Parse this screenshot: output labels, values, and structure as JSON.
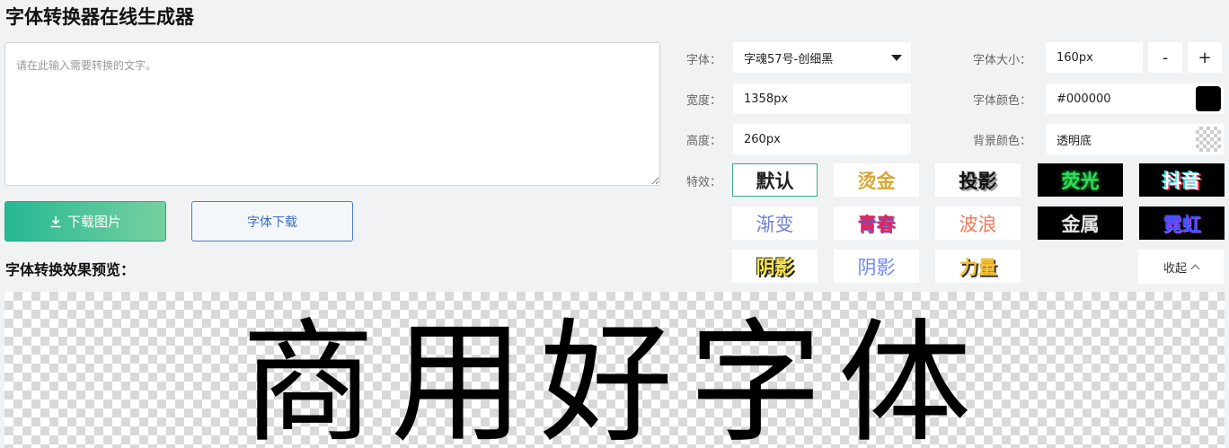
{
  "page": {
    "title": "字体转换器在线生成器"
  },
  "input": {
    "placeholder": "请在此输入需要转换的文字。"
  },
  "buttons": {
    "download_image": "下载图片",
    "font_download": "字体下载",
    "collapse": "收起"
  },
  "preview": {
    "label": "字体转换效果预览：",
    "text": "商用好字体"
  },
  "settings": {
    "font_label": "字体：",
    "font_value": "字魂57号-创细黑",
    "width_label": "宽度：",
    "width_value": "1358px",
    "height_label": "高度：",
    "height_value": "260px",
    "size_label": "字体大小：",
    "size_value": "160px",
    "minus": "-",
    "plus": "+",
    "color_label": "字体颜色：",
    "color_value": "#000000",
    "color_swatch": "#000000",
    "bg_label": "背景颜色：",
    "bg_value": "透明底"
  },
  "effects": {
    "label": "特效：",
    "items": [
      {
        "label": "默认",
        "selected": true
      },
      {
        "label": "烫金"
      },
      {
        "label": "投影"
      },
      {
        "label": "荧光"
      },
      {
        "label": "抖音"
      },
      {
        "label": "渐变"
      },
      {
        "label": "青春"
      },
      {
        "label": "波浪"
      },
      {
        "label": "金属"
      },
      {
        "label": "霓虹"
      },
      {
        "label": "阴影"
      },
      {
        "label": "阴影"
      },
      {
        "label": "力量"
      }
    ]
  },
  "colors": {
    "accent": "#26b894",
    "link_blue": "#3b6dc4",
    "page_bg": "#f0f2f4"
  },
  "icons": {
    "download": "download-icon",
    "font_dropdown": "caret-down-icon",
    "collapse": "chevron-up-icon"
  }
}
